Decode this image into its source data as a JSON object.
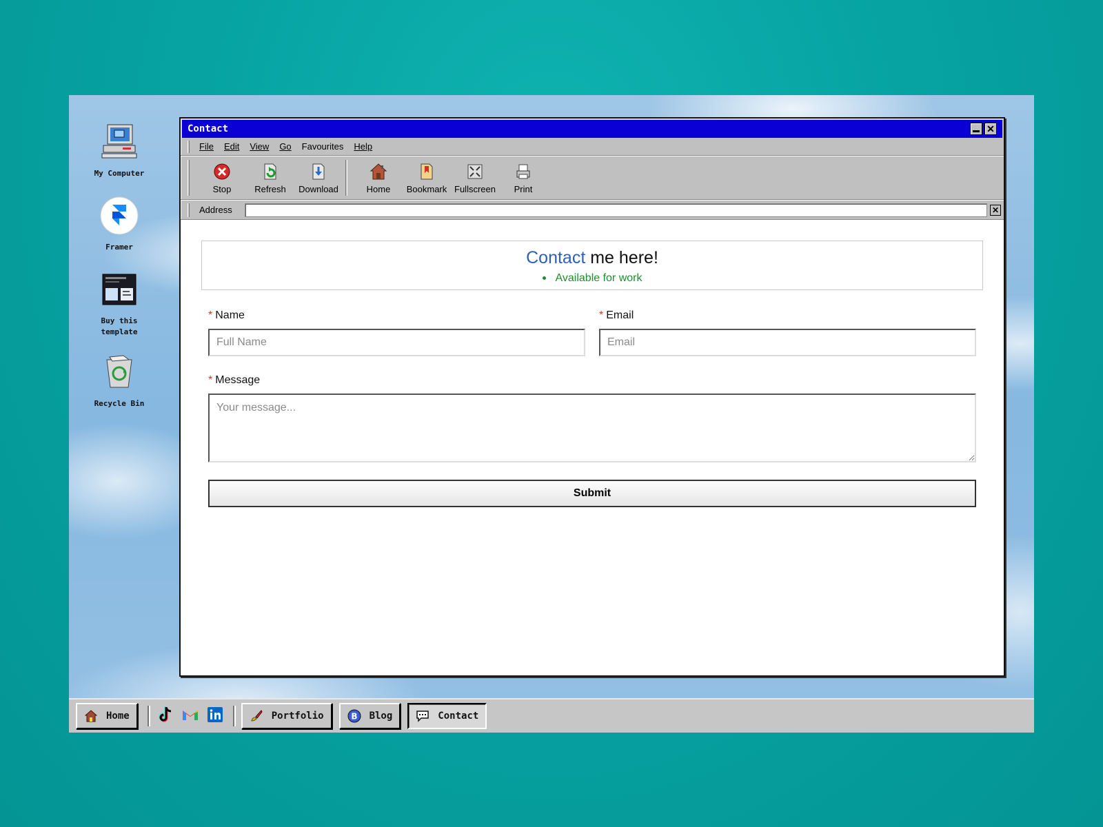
{
  "desktop": {
    "icons": [
      {
        "label": "My Computer",
        "icon": "computer-icon"
      },
      {
        "label": "Framer",
        "icon": "framer-icon"
      },
      {
        "label": "Buy this template",
        "icon": "template-icon"
      },
      {
        "label": "Recycle Bin",
        "icon": "recycle-bin-icon"
      }
    ]
  },
  "window": {
    "title": "Contact",
    "menu": [
      "File",
      "Edit",
      "View",
      "Go",
      "Favourites",
      "Help"
    ],
    "toolbar": {
      "stop": "Stop",
      "refresh": "Refresh",
      "download": "Download",
      "home": "Home",
      "bookmark": "Bookmark",
      "fullscreen": "Fullscreen",
      "print": "Print"
    },
    "address": {
      "label": "Address",
      "value": ""
    }
  },
  "page": {
    "heading_accent": "Contact",
    "heading_rest": " me here!",
    "status": "Available for work",
    "form": {
      "name_label": "Name",
      "name_placeholder": "Full Name",
      "email_label": "Email",
      "email_placeholder": "Email",
      "message_label": "Message",
      "message_placeholder": "Your message...",
      "required_mark": "*",
      "submit": "Submit"
    }
  },
  "taskbar": {
    "home": "Home",
    "portfolio": "Portfolio",
    "blog": "Blog",
    "contact": "Contact"
  },
  "colors": {
    "titlebar": "#0a00d6",
    "accent": "#2f5fb8",
    "status": "#1e8e2c",
    "required": "#e0302a"
  }
}
